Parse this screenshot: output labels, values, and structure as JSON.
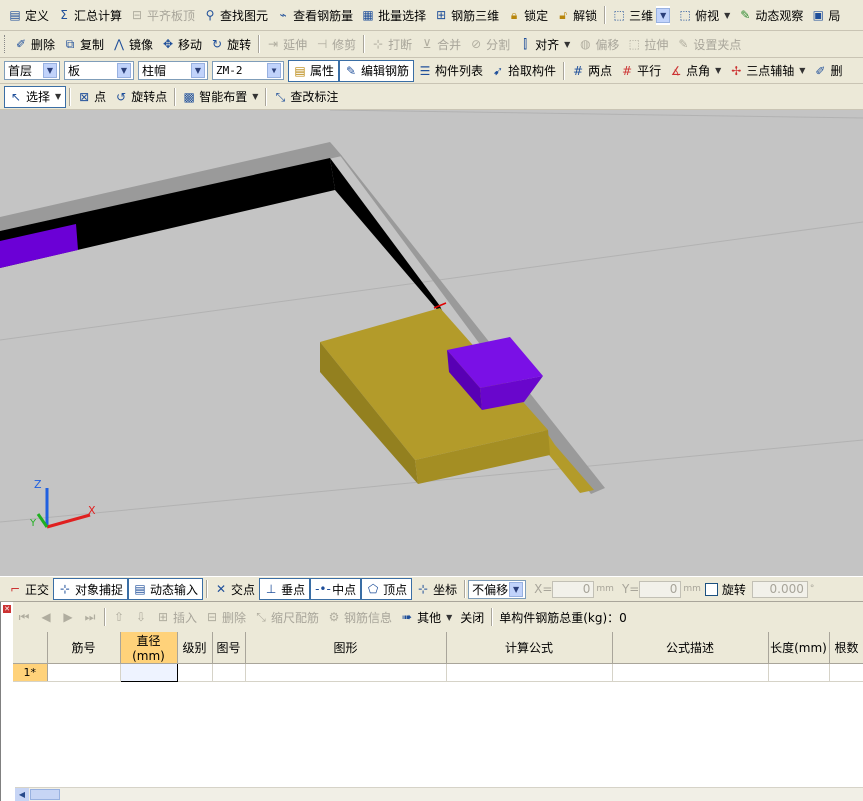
{
  "toolbar1": {
    "define": "定义",
    "summary_calc": "汇总计算",
    "flat_slab_top": "平齐板顶",
    "find_element": "查找图元",
    "view_rebar_qty": "查看钢筋量",
    "batch_select": "批量选择",
    "rebar_3d": "钢筋三维",
    "lock": "锁定",
    "unlock": "解锁",
    "view_3d": "三维",
    "top_view": "俯视",
    "dynamic_observe": "动态观察",
    "truncated": "局"
  },
  "toolbar2": {
    "delete": "删除",
    "copy": "复制",
    "mirror": "镜像",
    "move": "移动",
    "rotate": "旋转",
    "extend": "延伸",
    "trim": "修剪",
    "break": "打断",
    "merge": "合并",
    "split": "分割",
    "align": "对齐",
    "offset": "偏移",
    "stretch": "拉伸",
    "set_grip": "设置夹点"
  },
  "toolbar3": {
    "floor": "首层",
    "category": "板",
    "element_type": "柱帽",
    "element_name": "ZM-2",
    "properties": "属性",
    "edit_rebar": "编辑钢筋",
    "element_list": "构件列表",
    "pick_element": "拾取构件",
    "two_points": "两点",
    "parallel": "平行",
    "point_angle": "点角",
    "three_point_axis": "三点辅轴",
    "truncated": "删"
  },
  "toolbar4": {
    "select": "选择",
    "point": "点",
    "rotate_point": "旋转点",
    "smart_layout": "智能布置",
    "edit_annotation": "查改标注"
  },
  "snapbar": {
    "ortho": "正交",
    "object_snap": "对象捕捉",
    "dynamic_input": "动态输入",
    "intersection": "交点",
    "perpendicular": "垂点",
    "midpoint": "中点",
    "vertex": "顶点",
    "coordinate": "坐标",
    "offset_mode": "不偏移",
    "x_label": "X=",
    "x_value": "0",
    "y_label": "Y=",
    "y_value": "0",
    "unit": "mm",
    "rotate": "旋转",
    "rotate_value": "0.000",
    "degree": "°"
  },
  "gridbar": {
    "insert": "插入",
    "delete": "删除",
    "scale_rebar": "缩尺配筋",
    "rebar_info": "钢筋信息",
    "other": "其他",
    "close": "关闭",
    "total_weight_label": "单构件钢筋总重(kg)：0"
  },
  "grid": {
    "columns": [
      "筋号",
      "直径(mm)",
      "级别",
      "图号",
      "图形",
      "计算公式",
      "公式描述",
      "长度(mm)",
      "根数"
    ],
    "rows": [
      {
        "header": "1*",
        "cells": [
          "",
          "",
          "",
          "",
          "",
          "",
          "",
          "",
          ""
        ]
      }
    ]
  },
  "viewport": {
    "axis_x": "X",
    "axis_y": "Y",
    "axis_z": "Z",
    "colors": {
      "background": "#c4c4c4",
      "slab": "#b39b2a",
      "column_cap": "#7000e0",
      "beam": "#000000"
    }
  }
}
